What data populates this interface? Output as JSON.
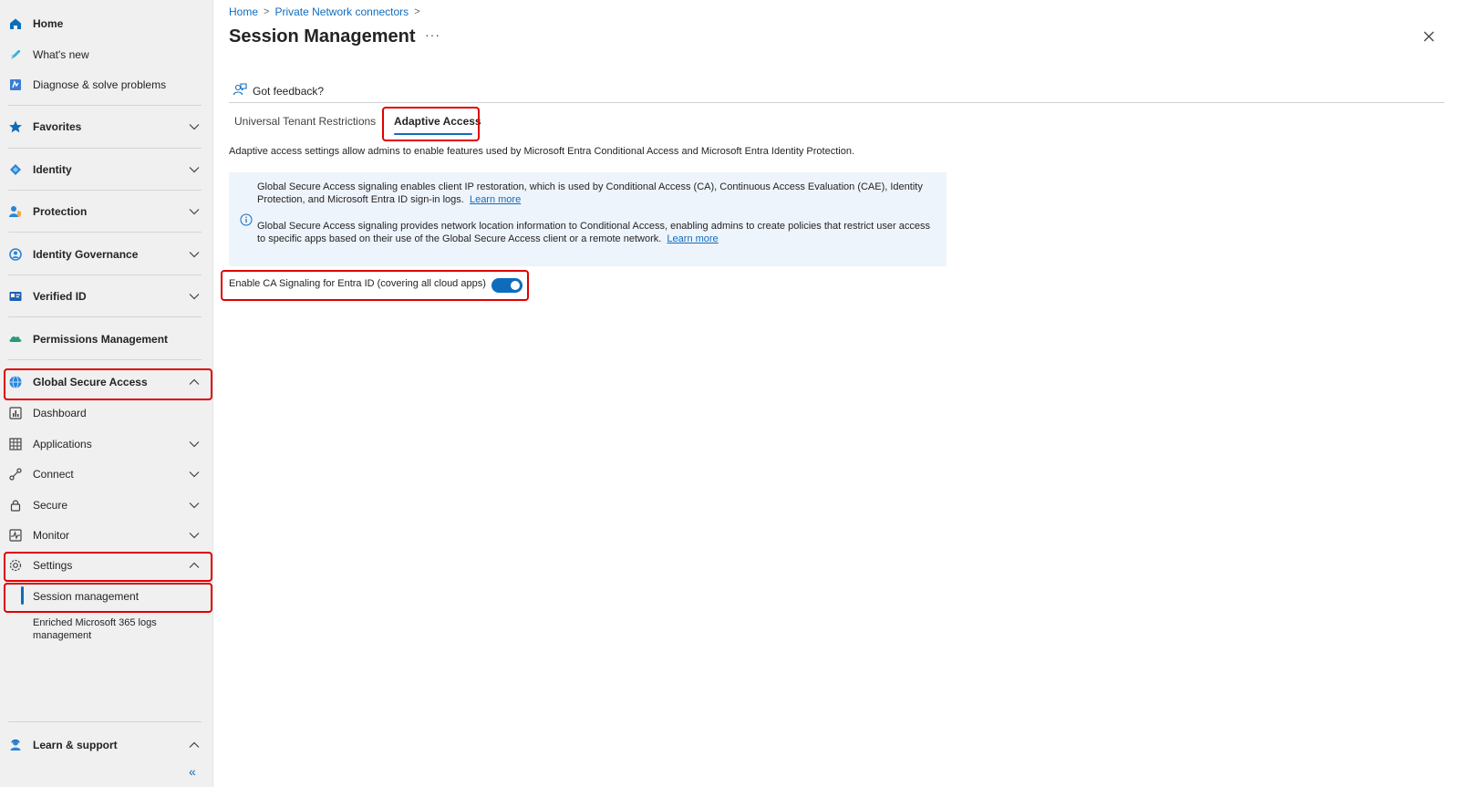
{
  "sidebar": {
    "items": [
      {
        "label": "Home",
        "icon": "home-icon"
      },
      {
        "label": "What's new",
        "icon": "rocket-icon"
      },
      {
        "label": "Diagnose & solve problems",
        "icon": "diagnose-icon"
      },
      {
        "label": "Favorites",
        "icon": "star-icon"
      },
      {
        "label": "Identity",
        "icon": "identity-icon"
      },
      {
        "label": "Protection",
        "icon": "protection-icon"
      },
      {
        "label": "Identity Governance",
        "icon": "governance-icon"
      },
      {
        "label": "Verified ID",
        "icon": "verified-id-icon"
      },
      {
        "label": "Permissions Management",
        "icon": "cloud-icon"
      },
      {
        "label": "Global Secure Access",
        "icon": "globe-icon"
      },
      {
        "label": "Dashboard",
        "icon": "dashboard-icon"
      },
      {
        "label": "Applications",
        "icon": "grid-icon"
      },
      {
        "label": "Connect",
        "icon": "connect-icon"
      },
      {
        "label": "Secure",
        "icon": "lock-icon"
      },
      {
        "label": "Monitor",
        "icon": "monitor-icon"
      },
      {
        "label": "Settings",
        "icon": "gear-icon"
      },
      {
        "label": "Session management"
      },
      {
        "label": "Enriched Microsoft 365 logs management"
      },
      {
        "label": "Learn & support",
        "icon": "support-icon"
      }
    ],
    "collapse_glyph": "«"
  },
  "breadcrumb": {
    "home": "Home",
    "connectors": "Private Network connectors",
    "sep": ">"
  },
  "page": {
    "title": "Session Management",
    "more": "···",
    "feedback": "Got feedback?"
  },
  "tabs": [
    {
      "label": "Universal Tenant Restrictions"
    },
    {
      "label": "Adaptive Access",
      "selected": true
    }
  ],
  "description": "Adaptive access settings allow admins to enable features used by Microsoft Entra Conditional Access and Microsoft Entra Identity Protection.",
  "info": {
    "p1": "Global Secure Access signaling enables client IP restoration, which is used by Conditional Access (CA), Continuous Access Evaluation (CAE), Identity Protection, and Microsoft Entra ID sign-in logs.",
    "p2": "Global Secure Access signaling provides network location information to Conditional Access, enabling admins to create policies that restrict user access to specific apps based on their use of the Global Secure Access client or a remote network.",
    "learn_more": "Learn more"
  },
  "toggle": {
    "label": "Enable CA Signaling for Entra ID (covering all cloud apps)",
    "on": true
  },
  "colors": {
    "accent": "#0f6cbd",
    "highlight": "#e00000"
  }
}
